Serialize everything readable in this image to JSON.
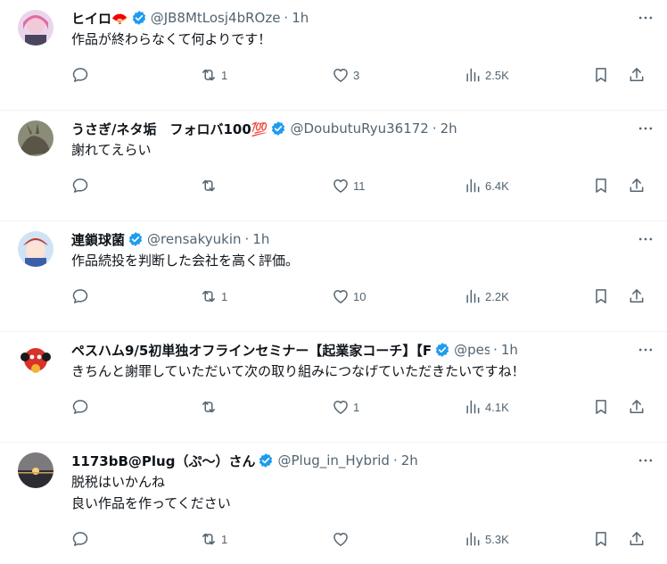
{
  "tweets": [
    {
      "name": "ヒイロ🪭",
      "handle": "@JB8MtLosj4bROze",
      "time": "1h",
      "text": "作品が終わらなくて何よりです！",
      "reply_count": "",
      "retweet_count": "1",
      "like_count": "3",
      "view_count": "2.5K",
      "avatar_color": "#c9a3c9"
    },
    {
      "name": "うさぎ/ネタ垢　フォロバ100💯",
      "handle": "@DoubutuRyu36172",
      "time": "2h",
      "text": "謝れてえらい",
      "reply_count": "",
      "retweet_count": "",
      "like_count": "11",
      "view_count": "6.4K",
      "avatar_color": "#6b6e5e"
    },
    {
      "name": "連鎖球菌",
      "handle": "@rensakyukin",
      "time": "1h",
      "text": "作品続投を判断した会社を高く評価。",
      "reply_count": "",
      "retweet_count": "1",
      "like_count": "10",
      "view_count": "2.2K",
      "avatar_color": "#a6c7e6"
    },
    {
      "name": "ペスハム9/5初単独オフラインセミナー【起業家コーチ】【F",
      "handle": "@pes",
      "time": "1h",
      "text": "きちんと謝罪していただいて次の取り組みにつなげていただきたいですね！",
      "reply_count": "",
      "retweet_count": "",
      "like_count": "1",
      "view_count": "4.1K",
      "avatar_color": "#d8322a"
    },
    {
      "name": "1173bB@Plug（ぷ〜）さん",
      "handle": "@Plug_in_Hybrid",
      "time": "2h",
      "text": "脱税はいかんね\n良い作品を作ってください",
      "reply_count": "",
      "retweet_count": "1",
      "like_count": "",
      "view_count": "5.3K",
      "avatar_color": "#3a3a44"
    }
  ],
  "dot": "·",
  "colors": {
    "verified": "#1d9bf0",
    "muted": "#536471",
    "text": "#0f1419",
    "divider": "#eff3f4"
  },
  "icons": [
    "reply-icon",
    "retweet-icon",
    "like-icon",
    "views-icon",
    "bookmark-icon",
    "share-icon",
    "more-icon",
    "verified-badge-icon"
  ]
}
